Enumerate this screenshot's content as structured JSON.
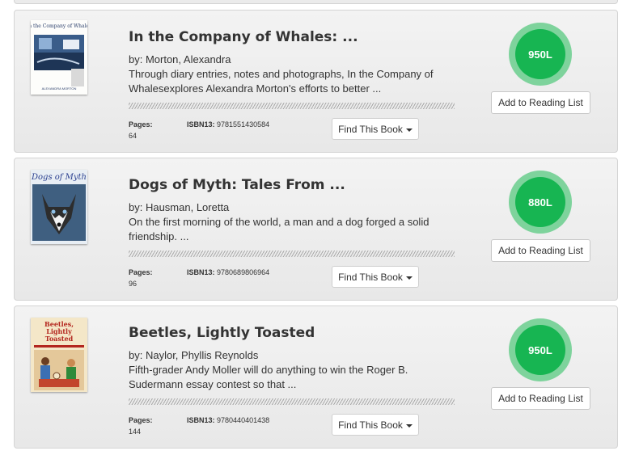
{
  "books": [
    {
      "title": "In the Company of Whales: ...",
      "author": "by: Morton, Alexandra",
      "description": "Through diary entries, notes and photographs, In the Company of Whalesexplores Alexandra Morton's efforts to better ...",
      "pages_label": "Pages:",
      "pages": "64",
      "isbn_label": "ISBN13:",
      "isbn": "9781551430584",
      "find_label": "Find This Book",
      "lexile": "950L",
      "add_label": "Add to Reading List",
      "cover_title": "In the Company of Whales"
    },
    {
      "title": "Dogs of Myth: Tales From ...",
      "author": "by: Hausman, Loretta",
      "description": "On the first morning of the world, a man and a dog forged a solid friendship. ...",
      "pages_label": "Pages:",
      "pages": "96",
      "isbn_label": "ISBN13:",
      "isbn": "9780689806964",
      "find_label": "Find This Book",
      "lexile": "880L",
      "add_label": "Add to Reading List",
      "cover_title": "Dogs of Myth"
    },
    {
      "title": "Beetles, Lightly Toasted",
      "author": "by: Naylor, Phyllis Reynolds",
      "description": "Fifth-grader Andy Moller will do anything to win the Roger B. Sudermann essay contest so that ...",
      "pages_label": "Pages:",
      "pages": "144",
      "isbn_label": "ISBN13:",
      "isbn": "9780440401438",
      "find_label": "Find This Book",
      "lexile": "950L",
      "add_label": "Add to Reading List",
      "cover_title": "Beetles, Lightly Toasted"
    }
  ],
  "colors": {
    "lexile_ring": "#7ed39c",
    "lexile_core": "#17b552",
    "card_bg": "#eeeeee"
  }
}
